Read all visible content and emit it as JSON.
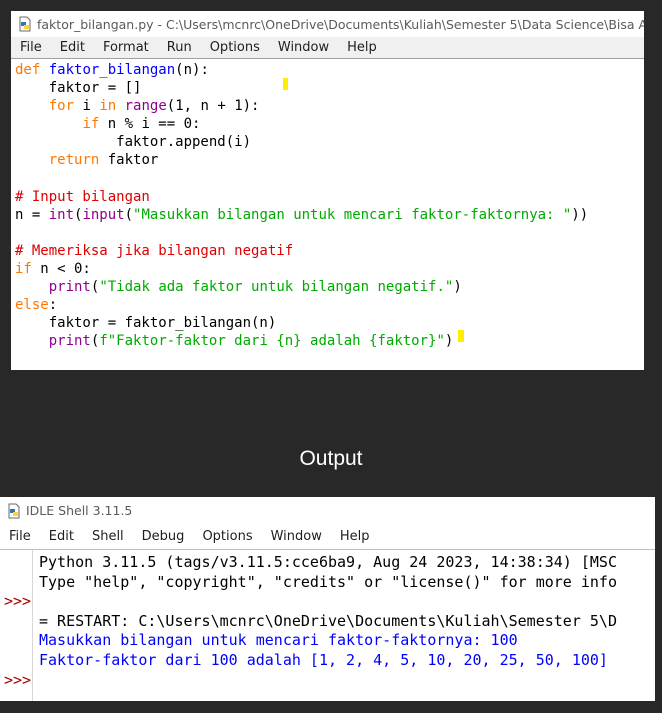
{
  "editor_window": {
    "title": "faktor_bilangan.py - C:\\Users\\mcnrc\\OneDrive\\Documents\\Kuliah\\Semester 5\\Data Science\\Bisa AI Ac",
    "icon": "python-file-icon",
    "menu": [
      "File",
      "Edit",
      "Format",
      "Run",
      "Options",
      "Window",
      "Help"
    ],
    "code": [
      [
        {
          "t": "def",
          "c": "kw"
        },
        {
          "t": " "
        },
        {
          "t": "faktor_bilangan",
          "c": "df"
        },
        {
          "t": "(n):"
        }
      ],
      [
        {
          "t": "    faktor = []"
        }
      ],
      [
        {
          "t": "    "
        },
        {
          "t": "for",
          "c": "kw"
        },
        {
          "t": " i "
        },
        {
          "t": "in",
          "c": "kw"
        },
        {
          "t": " "
        },
        {
          "t": "range",
          "c": "bi"
        },
        {
          "t": "(1, n + 1):"
        }
      ],
      [
        {
          "t": "        "
        },
        {
          "t": "if",
          "c": "kw"
        },
        {
          "t": " n % i == 0:"
        }
      ],
      [
        {
          "t": "            faktor.append(i)"
        }
      ],
      [
        {
          "t": "    "
        },
        {
          "t": "return",
          "c": "kw"
        },
        {
          "t": " faktor"
        }
      ],
      [],
      [
        {
          "t": "# Input bilangan",
          "c": "cm"
        }
      ],
      [
        {
          "t": "n = "
        },
        {
          "t": "int",
          "c": "bi"
        },
        {
          "t": "("
        },
        {
          "t": "input",
          "c": "bi"
        },
        {
          "t": "("
        },
        {
          "t": "\"Masukkan bilangan untuk mencari faktor-faktornya: \"",
          "c": "st"
        },
        {
          "t": "))"
        }
      ],
      [],
      [
        {
          "t": "# Memeriksa jika bilangan negatif",
          "c": "cm"
        }
      ],
      [
        {
          "t": "if",
          "c": "kw"
        },
        {
          "t": " n < 0:"
        }
      ],
      [
        {
          "t": "    "
        },
        {
          "t": "print",
          "c": "bi"
        },
        {
          "t": "("
        },
        {
          "t": "\"Tidak ada faktor untuk bilangan negatif.\"",
          "c": "st"
        },
        {
          "t": ")"
        }
      ],
      [
        {
          "t": "else",
          "c": "kw"
        },
        {
          "t": ":"
        }
      ],
      [
        {
          "t": "    faktor = faktor_bilangan(n)"
        }
      ],
      [
        {
          "t": "    "
        },
        {
          "t": "print",
          "c": "bi"
        },
        {
          "t": "("
        },
        {
          "t": "f\"Faktor-faktor dari {n} adalah {faktor}\"",
          "c": "st"
        },
        {
          "t": ")"
        }
      ]
    ]
  },
  "output_label": "Output",
  "shell_window": {
    "title": "IDLE Shell 3.11.5",
    "icon": "python-shell-icon",
    "menu": [
      "File",
      "Edit",
      "Shell",
      "Debug",
      "Options",
      "Window",
      "Help"
    ],
    "lines": [
      {
        "prompt": "",
        "text": "Python 3.11.5 (tags/v3.11.5:cce6ba9, Aug 24 2023, 14:38:34) [MSC",
        "color": "black"
      },
      {
        "prompt": "",
        "text": "Type \"help\", \"copyright\", \"credits\" or \"license()\" for more info",
        "color": "black"
      },
      {
        "prompt": ">>>",
        "text": "",
        "color": "black"
      },
      {
        "prompt": "",
        "text": "= RESTART: C:\\Users\\mcnrc\\OneDrive\\Documents\\Kuliah\\Semester 5\\D",
        "color": "black"
      },
      {
        "prompt": "",
        "text": "Masukkan bilangan untuk mencari faktor-faktornya: 100",
        "color": "blue"
      },
      {
        "prompt": "",
        "text": "Faktor-faktor dari 100 adalah [1, 2, 4, 5, 10, 20, 25, 50, 100]",
        "color": "blue"
      },
      {
        "prompt": ">>>",
        "text": "",
        "color": "black"
      }
    ]
  },
  "colors": {
    "keyword": "#ff7700",
    "builtin": "#900090",
    "string": "#00aa00",
    "comment": "#dd0000",
    "definition": "#0000ff",
    "shell_output": "#0000ff",
    "shell_prompt": "#a40000",
    "background": "#282828"
  }
}
